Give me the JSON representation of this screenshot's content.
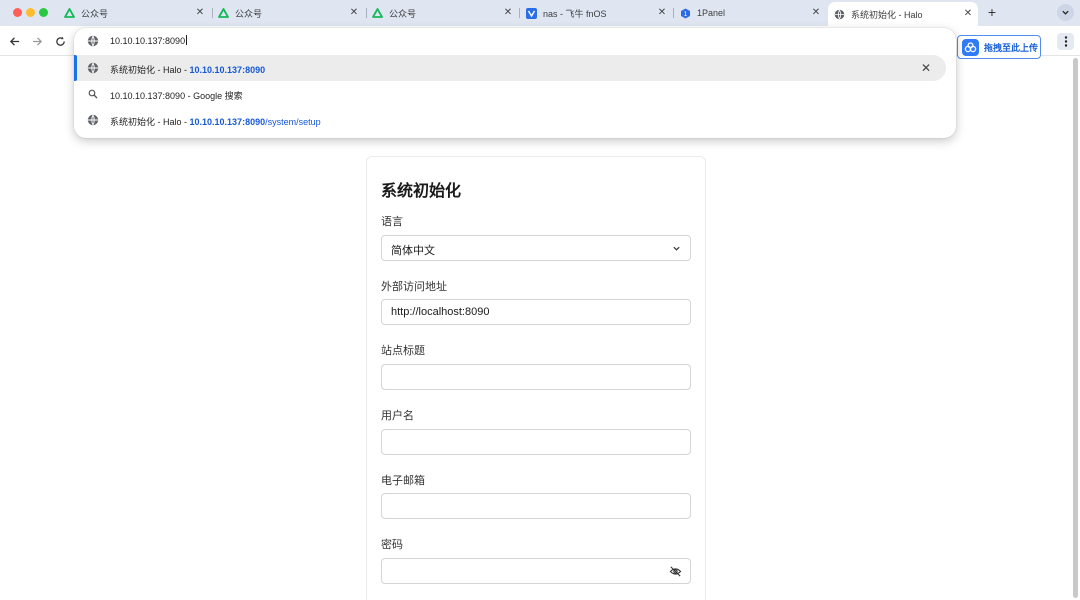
{
  "browser": {
    "tabs": [
      {
        "title": "公众号",
        "icon": "wechat-public-icon"
      },
      {
        "title": "公众号",
        "icon": "wechat-public-icon"
      },
      {
        "title": "公众号",
        "icon": "wechat-public-icon"
      },
      {
        "title": "nas - 飞牛 fnOS",
        "icon": "fnos-icon"
      },
      {
        "title": "1Panel",
        "icon": "1panel-icon"
      },
      {
        "title": "系统初始化 - Halo",
        "icon": "globe-icon",
        "active": true
      }
    ],
    "new_tab": "+",
    "address": "10.10.10.137:8090",
    "suggestions": [
      {
        "prefix": "系统初始化 - Halo - ",
        "host": "10.10.10.137:8090",
        "path": "",
        "icon": "globe-icon"
      },
      {
        "prefix": "10.10.10.137:8090 - Google 搜索",
        "icon": "search-icon"
      },
      {
        "prefix": "系统初始化 - Halo - ",
        "host": "10.10.10.137:8090",
        "path": "/system/setup",
        "icon": "globe-icon"
      }
    ],
    "extension_label": "拖拽至此上传",
    "colors": {
      "accent": "#1a73e8",
      "tabstrip": "#dfe6f2"
    }
  },
  "page": {
    "title": "系统初始化",
    "fields": [
      {
        "label": "语言",
        "value": "简体中文",
        "type": "select"
      },
      {
        "label": "外部访问地址",
        "value": "http://localhost:8090",
        "type": "text"
      },
      {
        "label": "站点标题",
        "value": "",
        "type": "text"
      },
      {
        "label": "用户名",
        "value": "",
        "type": "text"
      },
      {
        "label": "电子邮箱",
        "value": "",
        "type": "text"
      },
      {
        "label": "密码",
        "value": "",
        "type": "password"
      }
    ]
  }
}
